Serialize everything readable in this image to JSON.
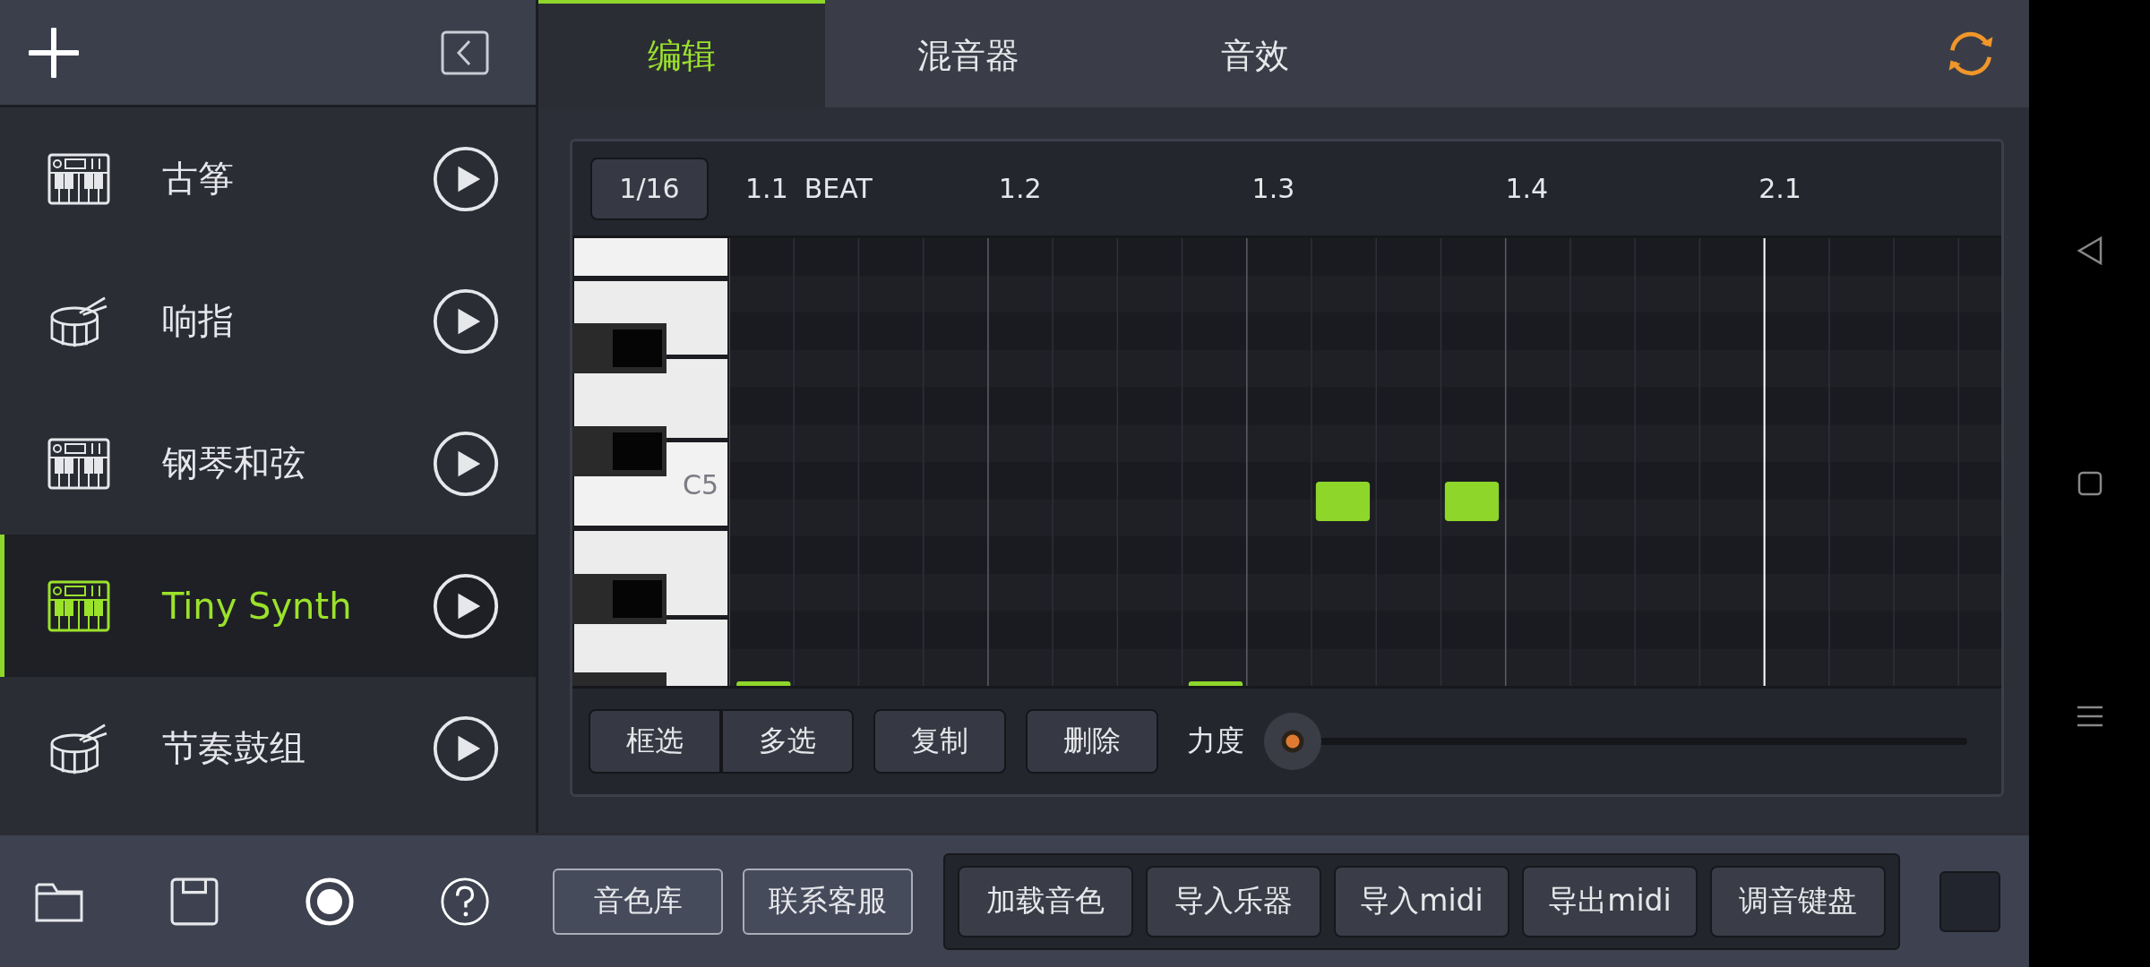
{
  "sidebar": {
    "items": [
      {
        "name": "古筝",
        "kind": "keyboard",
        "selected": false
      },
      {
        "name": "响指",
        "kind": "drum",
        "selected": false
      },
      {
        "name": "钢琴和弦",
        "kind": "keyboard",
        "selected": false
      },
      {
        "name": "Tiny Synth",
        "kind": "keyboard",
        "selected": true
      },
      {
        "name": "节奏鼓组",
        "kind": "drum",
        "selected": false
      }
    ]
  },
  "tabs": [
    {
      "label": "编辑",
      "selected": true
    },
    {
      "label": "混音器",
      "selected": false
    },
    {
      "label": "音效",
      "selected": false
    }
  ],
  "editor": {
    "grid_button": "1/16",
    "beat_label": "BEAT",
    "ruler": [
      "1.1",
      "1.2",
      "1.3",
      "1.4",
      "2.1"
    ],
    "key_label": "C5",
    "tools": [
      "框选",
      "多选",
      "复制",
      "删除"
    ],
    "velocity": {
      "label": "力度",
      "level": 0
    }
  },
  "bottom_bar": {
    "library_buttons": [
      "音色库",
      "联系客服"
    ],
    "actions": [
      "加载音色",
      "导入乐器",
      "导入midi",
      "导出midi",
      "调音键盘"
    ]
  }
}
